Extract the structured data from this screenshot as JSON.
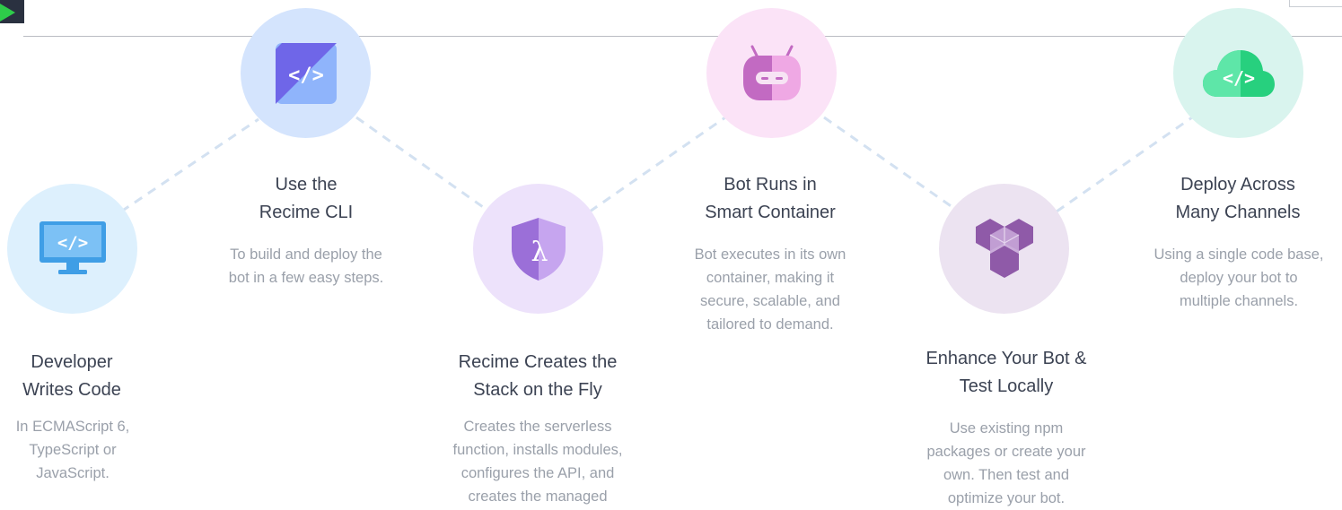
{
  "steps": [
    {
      "title": "Developer\nWrites Code",
      "desc": "In ECMAScript 6,\nTypeScript or\nJavaScript.",
      "icon": "monitor-code-icon",
      "circle_color": "#ddf0fd"
    },
    {
      "title": "Use the\nRecime CLI",
      "desc": "To build and deploy the\nbot in a few easy steps.",
      "icon": "code-tile-icon",
      "circle_color": "#d4e4fd"
    },
    {
      "title": "Recime Creates the\nStack on the Fly",
      "desc": "Creates the serverless\nfunction, installs modules,\nconfigures the API, and\ncreates the managed",
      "icon": "lambda-shield-icon",
      "circle_color": "#ede2fb"
    },
    {
      "title": "Bot Runs in\nSmart Container",
      "desc": "Bot executes in its own\ncontainer, making it\nsecure, scalable, and\ntailored to demand.",
      "icon": "robot-head-icon",
      "circle_color": "#fbe3f7"
    },
    {
      "title": "Enhance Your Bot &\nTest Locally",
      "desc": "Use existing npm\npackages or create your\nown. Then test and\noptimize your bot.",
      "icon": "cubes-icon",
      "circle_color": "#ece3f1"
    },
    {
      "title": "Deploy Across\nMany Channels",
      "desc": "Using a single code base,\ndeploy your bot to\nmultiple channels.",
      "icon": "cloud-code-icon",
      "circle_color": "#d9f4ee"
    }
  ],
  "colors": {
    "title": "#3c4353",
    "desc": "#9aa0aa",
    "connector": "#d3e1f1"
  }
}
